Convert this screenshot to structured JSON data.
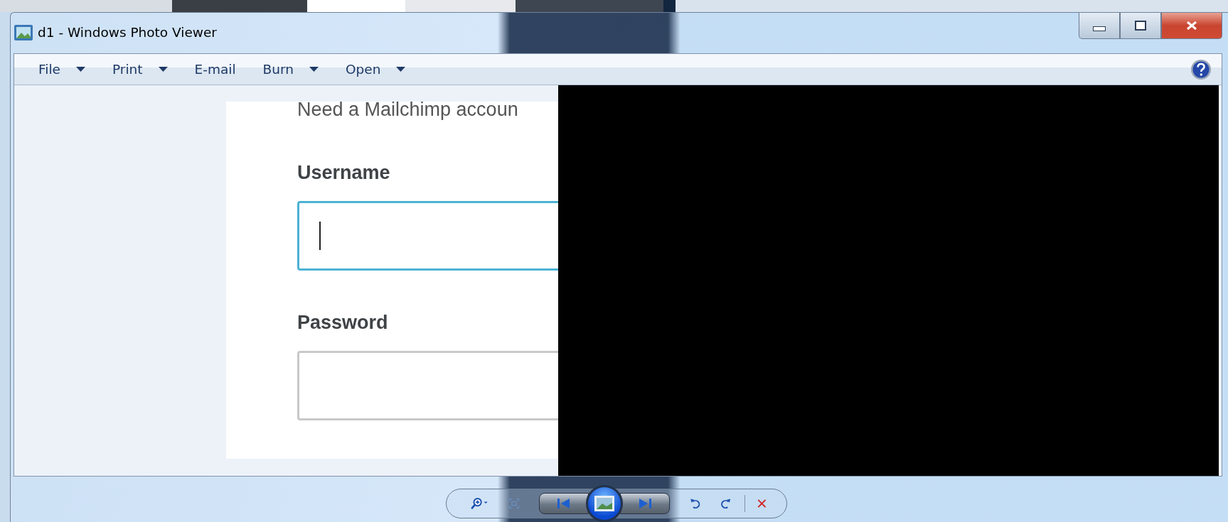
{
  "window": {
    "title": "d1 - Windows Photo Viewer"
  },
  "menu": [
    {
      "label": "File",
      "dropdown": true
    },
    {
      "label": "Print",
      "dropdown": true
    },
    {
      "label": "E-mail",
      "dropdown": false
    },
    {
      "label": "Burn",
      "dropdown": true
    },
    {
      "label": "Open",
      "dropdown": true
    }
  ],
  "image": {
    "intro": "Need a Mailchimp accoun",
    "fields": [
      {
        "label": "Username",
        "focused": true
      },
      {
        "label": "Password",
        "focused": false
      }
    ]
  }
}
